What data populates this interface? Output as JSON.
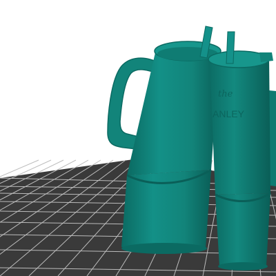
{
  "viewport": {
    "background": "#ffffff",
    "bed_color": "#3a3a3a",
    "grid_line_color": "#bdbdbd"
  },
  "models": [
    {
      "name": "tumbler-left",
      "color": "#12847a",
      "shade": "#0b6a62",
      "highlight": "#2aa197"
    },
    {
      "name": "tumbler-right",
      "color": "#12847a",
      "shade": "#0b6a62",
      "highlight": "#2aa197",
      "embossed_text": [
        "the",
        "ANLEY"
      ]
    }
  ]
}
